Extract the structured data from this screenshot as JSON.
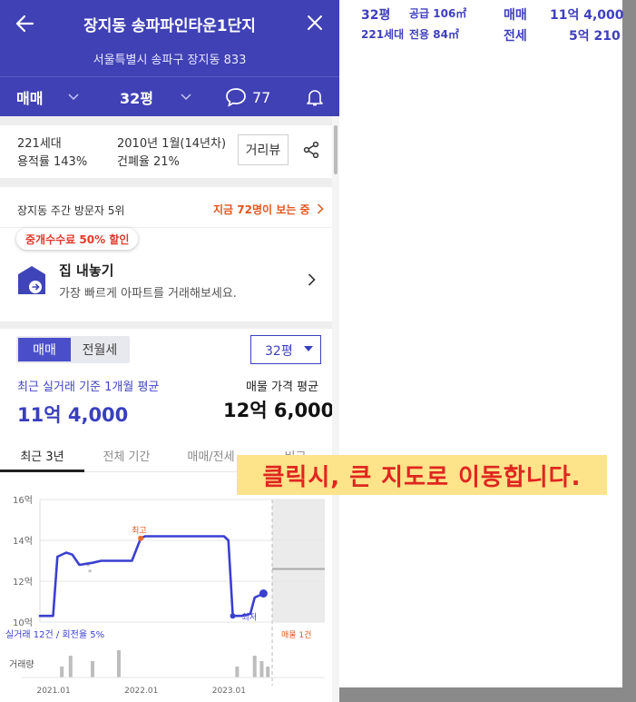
{
  "map_info": {
    "row1": {
      "pyeong": "32평",
      "area": "공급 106㎡",
      "type": "매매",
      "price": "11억 4,000"
    },
    "row2": {
      "pyeong": "221세대",
      "area": "전용 84㎡",
      "type": "전세",
      "price": "5억 210"
    }
  },
  "header": {
    "title": "장지동 송파파인타운1단지",
    "address": "서울특별시 송파구 장지동 833",
    "filters": {
      "trade_type": "매매",
      "pyeong": "32평",
      "comments": "77"
    }
  },
  "summary": {
    "households": "221세대",
    "far": "용적률 143%",
    "built": "2010년 1월(14년차)",
    "bcr": "건폐율 21%",
    "street_view": "거리뷰"
  },
  "visitors": {
    "rank": "장지동 주간 방문자 5위",
    "live": "지금 72명이 보는 중"
  },
  "list_home": {
    "badge": "중개수수료 50% 할인",
    "title": "집 내놓기",
    "desc": "가장 빠르게 아파트를 거래해보세요."
  },
  "price": {
    "seg_sale": "매매",
    "seg_lease": "전월세",
    "pyeong": "32평",
    "recent_label": "최근 실거래 기준 1개월 평균",
    "recent_value": "11억 4,000",
    "listing_label": "매물 가격 평균",
    "listing_value": "12억 6,000"
  },
  "chart_tabs": [
    "최근 3년",
    "전체 기간",
    "매매/전세",
    "비교"
  ],
  "overlay": {
    "hint": "클릭시, 큰 지도로 이동합니다."
  },
  "chart_data": {
    "type": "line",
    "y_ticks": [
      "16억",
      "14억",
      "12억",
      "10억"
    ],
    "y_values": [
      16,
      14,
      12,
      10
    ],
    "ylim": [
      10,
      16
    ],
    "x_ticks": [
      "2021.01",
      "2022.01",
      "2023.01"
    ],
    "x_tick_values": [
      2021.0,
      2022.0,
      2023.0
    ],
    "xlim": [
      2020.85,
      2024.1
    ],
    "series": [
      {
        "x": [
          2020.85,
          2021.0,
          2021.05,
          2021.15,
          2021.22,
          2021.3,
          2021.45,
          2021.55,
          2021.65,
          2021.8,
          2021.9,
          2022.0,
          2022.05,
          2022.5,
          2022.95,
          2023.0,
          2023.05,
          2023.15,
          2023.25,
          2023.3,
          2023.4
        ],
        "y": [
          10.3,
          10.3,
          13.2,
          13.4,
          13.3,
          12.8,
          12.9,
          13.0,
          13.0,
          13.0,
          13.0,
          14.1,
          14.2,
          14.2,
          14.2,
          14.0,
          10.3,
          10.3,
          10.4,
          11.2,
          11.4
        ]
      }
    ],
    "high_point": {
      "x": 2022.0,
      "y": 14.1,
      "label": "최고"
    },
    "low_point": {
      "x": 2023.05,
      "y": 10.3,
      "label": "최저"
    },
    "last_point": {
      "x": 2023.4,
      "y": 11.4
    },
    "scatter_points": [
      {
        "x": 2021.4,
        "y": 12.8
      },
      {
        "x": 2021.42,
        "y": 12.5
      }
    ],
    "listing_line": {
      "x0": 2023.5,
      "x1": 2024.1,
      "y": 12.6
    },
    "volume_label": "거래량",
    "volume": [
      {
        "x": 2021.1,
        "v": 2
      },
      {
        "x": 2021.2,
        "v": 4
      },
      {
        "x": 2021.45,
        "v": 3
      },
      {
        "x": 2021.75,
        "v": 5
      },
      {
        "x": 2023.1,
        "v": 2
      },
      {
        "x": 2023.3,
        "v": 4
      },
      {
        "x": 2023.38,
        "v": 3
      },
      {
        "x": 2023.45,
        "v": 2
      }
    ],
    "footer_trades": "실거래 12건 / 회전율 5%",
    "footer_listings": "매물 1건"
  }
}
